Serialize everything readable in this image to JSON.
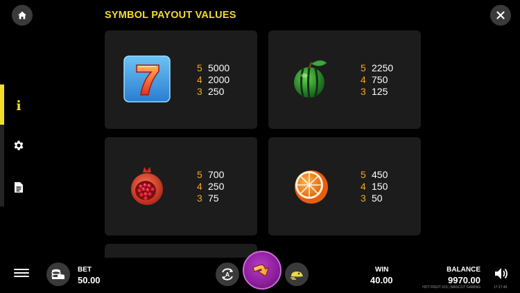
{
  "header": {
    "title": "SYMBOL PAYOUT VALUES"
  },
  "colors": {
    "accent": "#f2dd2d",
    "count": "#f2a81d",
    "panel": "#1c1c1c",
    "spin": "#8a1e9a"
  },
  "nav": {
    "info_label": "i",
    "info_icon": "info-icon",
    "settings_icon": "gear-icon",
    "rules_icon": "document-icon"
  },
  "symbols": [
    {
      "icon": "seven-icon",
      "pays": [
        {
          "count": "5",
          "value": "5000"
        },
        {
          "count": "4",
          "value": "2000"
        },
        {
          "count": "3",
          "value": "250"
        }
      ]
    },
    {
      "icon": "watermelon-icon",
      "pays": [
        {
          "count": "5",
          "value": "2250"
        },
        {
          "count": "4",
          "value": "750"
        },
        {
          "count": "3",
          "value": "125"
        }
      ]
    },
    {
      "icon": "pomegranate-icon",
      "pays": [
        {
          "count": "5",
          "value": "700"
        },
        {
          "count": "4",
          "value": "250"
        },
        {
          "count": "3",
          "value": "75"
        }
      ]
    },
    {
      "icon": "orange-icon",
      "pays": [
        {
          "count": "5",
          "value": "450"
        },
        {
          "count": "4",
          "value": "150"
        },
        {
          "count": "3",
          "value": "50"
        }
      ]
    }
  ],
  "footer": {
    "bet_label": "BET",
    "bet_value": "50.00",
    "win_label": "WIN",
    "win_value": "40.00",
    "balance_label": "BALANCE",
    "balance_value": "9970.00",
    "game_credit": "HOT FRUIT X15 | MASCOT GAMING",
    "clock": "17:17:46"
  }
}
